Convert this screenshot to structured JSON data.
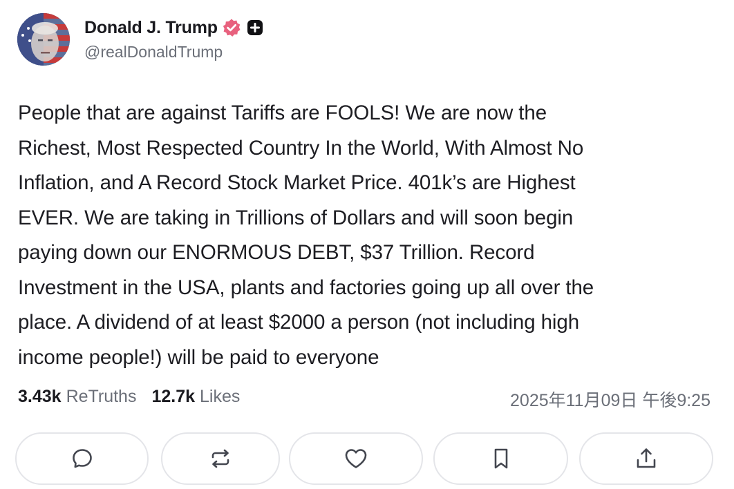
{
  "author": {
    "display_name": "Donald J. Trump",
    "handle": "@realDonaldTrump",
    "verified_icon": "verified-badge-icon",
    "badge_color": "#e8617e",
    "plus_icon": "plus-square-icon"
  },
  "post": {
    "lines": [
      "People that are against Tariffs are FOOLS! We are now the",
      "Richest, Most Respected Country In the World, With Almost No",
      "Inflation, and A Record Stock Market Price. 401k’s are Highest",
      "EVER. We are taking in Trillions of Dollars and will soon begin",
      "paying down our ENORMOUS DEBT, $37 Trillion. Record",
      "Investment in the USA, plants and factories going up all over the",
      "place. A dividend of at least $2000 a person (not including high",
      "income people!) will be paid to everyone"
    ]
  },
  "stats": {
    "retruths_count": "3.43k",
    "retruths_label": "ReTruths",
    "likes_count": "12.7k",
    "likes_label": "Likes"
  },
  "timestamp": "2025年11月09日 午後9:25",
  "actions": [
    {
      "name": "reply",
      "icon": "reply-bubble-icon"
    },
    {
      "name": "retruth",
      "icon": "repost-arrows-icon"
    },
    {
      "name": "like",
      "icon": "heart-icon"
    },
    {
      "name": "bookmark",
      "icon": "bookmark-icon"
    },
    {
      "name": "share",
      "icon": "share-upload-icon"
    }
  ]
}
